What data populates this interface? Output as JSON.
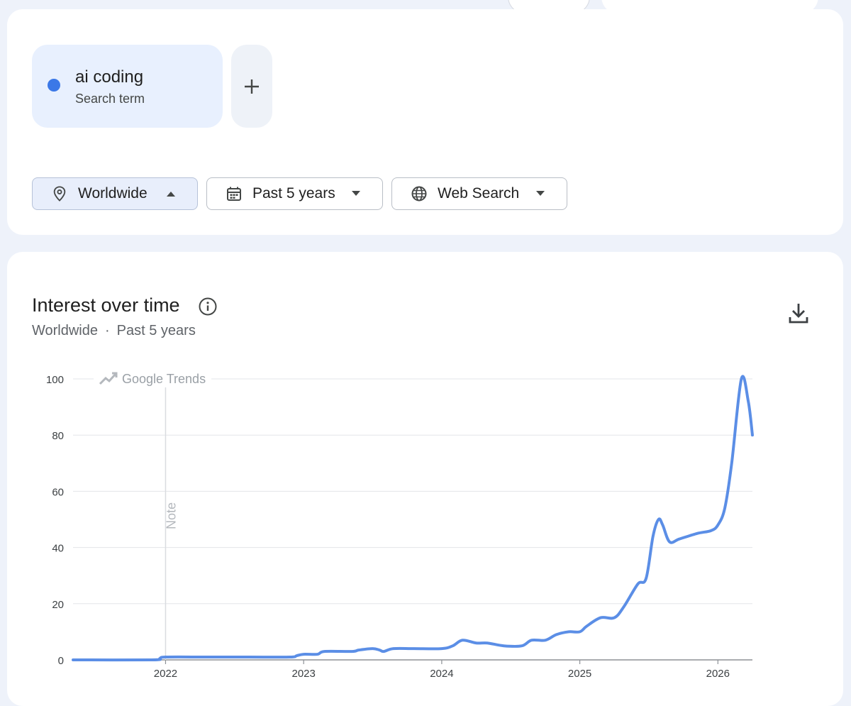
{
  "search_term": {
    "label": "ai coding",
    "type": "Search term",
    "color": "#3b78e7"
  },
  "filters": [
    {
      "label": "Worldwide",
      "icon": "location-pin-icon",
      "active": true
    },
    {
      "label": "Past 5 years",
      "icon": "calendar-icon",
      "active": false
    },
    {
      "label": "Web Search",
      "icon": "globe-icon",
      "active": false
    }
  ],
  "chart_card": {
    "title": "Interest over time",
    "subtitle_region": "Worldwide",
    "subtitle_sep": "·",
    "subtitle_period": "Past 5 years",
    "watermark": "Google Trends",
    "note_label": "Note"
  },
  "chart_data": {
    "type": "line",
    "ylim": [
      0,
      100
    ],
    "yticks": [
      0,
      20,
      40,
      60,
      80,
      100
    ],
    "xticks": [
      "2022",
      "2023",
      "2024",
      "2025",
      "2026"
    ],
    "xlim": [
      2021.33,
      2026.25
    ],
    "grid": true,
    "line_color": "#5b8ee6",
    "note_x": 2022.0,
    "series": [
      {
        "x": [
          2021.33,
          2021.9,
          2021.96,
          2022.0,
          2022.3,
          2022.6,
          2022.9,
          2022.95,
          2023.0,
          2023.1,
          2023.15,
          2023.35,
          2023.4,
          2023.5,
          2023.55,
          2023.58,
          2023.65,
          2023.8,
          2024.0,
          2024.08,
          2024.15,
          2024.25,
          2024.33,
          2024.45,
          2024.58,
          2024.65,
          2024.75,
          2024.83,
          2024.92,
          2025.0,
          2025.05,
          2025.15,
          2025.25,
          2025.32,
          2025.42,
          2025.48,
          2025.53,
          2025.57,
          2025.6,
          2025.65,
          2025.72,
          2025.85,
          2025.95,
          2026.0,
          2026.05,
          2026.1,
          2026.17,
          2026.22,
          2026.25
        ],
        "y": [
          0,
          0,
          0.5,
          1,
          1,
          1,
          1,
          1.5,
          2,
          2,
          3,
          3,
          3.5,
          4,
          3.5,
          3,
          4,
          4,
          4,
          5,
          7,
          6,
          6,
          5,
          5,
          7,
          7,
          9,
          10,
          10,
          12,
          15,
          15,
          19,
          27,
          29,
          44,
          50,
          48,
          42,
          43,
          45,
          46,
          48,
          54,
          70,
          100,
          92,
          80
        ]
      }
    ]
  }
}
